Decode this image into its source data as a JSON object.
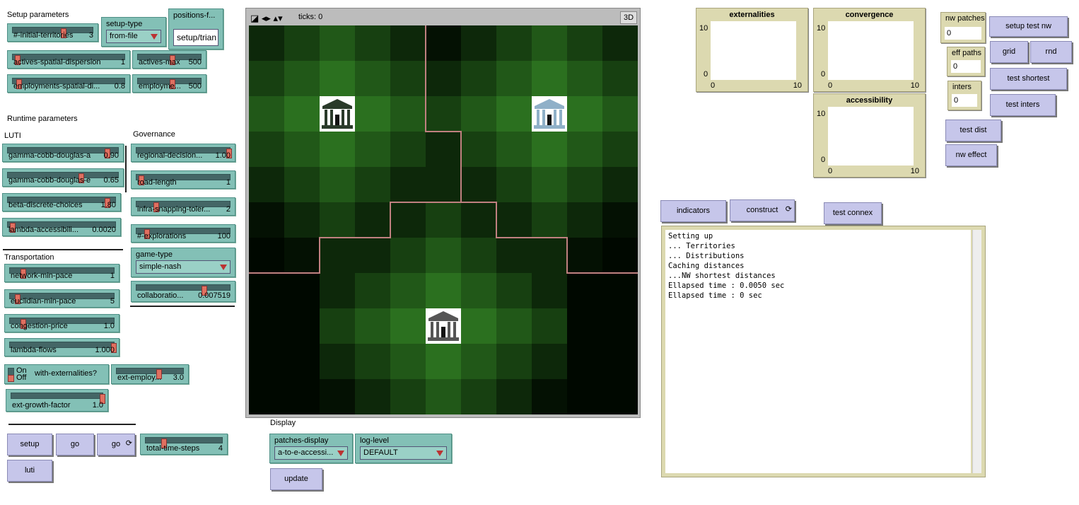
{
  "sections": {
    "setup_parameters": "Setup parameters",
    "runtime_parameters": "Runtime parameters",
    "luti": "LUTI",
    "governance": "Governance",
    "transportation": "Transportation",
    "display": "Display"
  },
  "setup": {
    "initial_territories": {
      "name": "#-initial-territories",
      "value": "3",
      "level": 0.6
    },
    "setup_type": {
      "name": "setup-type",
      "value": "from-file"
    },
    "positions_file": {
      "name": "positions-f...",
      "value": "setup/trian"
    },
    "actives_spatial_dispersion": {
      "name": "actives-spatial-dispersion",
      "value": "1",
      "level": 0.02
    },
    "actives_max": {
      "name": "actives-max",
      "value": "500",
      "level": 0.5
    },
    "employments_spatial": {
      "name": "employments-spatial-di...",
      "value": "0.8",
      "level": 0.03
    },
    "employments_max": {
      "name": "employme...",
      "value": "500",
      "level": 0.5
    }
  },
  "luti": {
    "gamma_cd_a": {
      "name": "gamma-cobb-douglas-a",
      "value": "0.90",
      "level": 0.9
    },
    "gamma_cd_e": {
      "name": "gamma-cobb-douglas-e",
      "value": "0.65",
      "level": 0.65
    },
    "beta_discrete": {
      "name": "beta-discrete-choices",
      "value": "1.80",
      "level": 0.92
    },
    "lambda_access": {
      "name": "lambda-accessibili...",
      "value": "0.0020",
      "level": 0.02
    }
  },
  "governance": {
    "regional_decision": {
      "name": "regional-decision...",
      "value": "1.00",
      "level": 1.0
    },
    "road_length": {
      "name": "road-length",
      "value": "1",
      "level": 0.02
    },
    "infra_snapping": {
      "name": "infra-snapping-toler...",
      "value": "2",
      "level": 0.18
    },
    "explorations": {
      "name": "#-explorations",
      "value": "100",
      "level": 0.08
    },
    "game_type": {
      "name": "game-type",
      "value": "simple-nash"
    },
    "collaboration": {
      "name": "collaboratio...",
      "value": "0.007519",
      "level": 0.7
    }
  },
  "transportation": {
    "network_min_pace": {
      "name": "network-min-pace",
      "value": "1",
      "level": 0.1
    },
    "euclidian_min_pace": {
      "name": "euclidian-min-pace",
      "value": "5",
      "level": 0.05
    },
    "congestion_price": {
      "name": "congestion-price",
      "value": "1.0",
      "level": 0.1
    },
    "lambda_flows": {
      "name": "lambda-flows",
      "value": "1.000",
      "level": 1.0
    }
  },
  "externalities": {
    "switch_on": "On",
    "switch_off": "Off",
    "switch_name": "with-externalities?",
    "ext_employ": {
      "name": "ext-employ...",
      "value": "3.0",
      "level": 0.6
    },
    "ext_growth": {
      "name": "ext-growth-factor",
      "value": "1.0",
      "level": 1.0
    }
  },
  "controls": {
    "setup": "setup",
    "go": "go",
    "go_forever": "go",
    "total_time_steps": {
      "name": "total-time-steps",
      "value": "4",
      "level": 0.2
    },
    "luti": "luti"
  },
  "view": {
    "ticks": "ticks: 0",
    "three_d": "3D"
  },
  "display": {
    "patches_display": {
      "name": "patches-display",
      "value": "a-to-e-accessi..."
    },
    "log_level": {
      "name": "log-level",
      "value": "DEFAULT"
    },
    "update": "update"
  },
  "plots": {
    "externalities": {
      "title": "externalities",
      "ymax": "10",
      "ymin": "0",
      "xmin": "0",
      "xmax": "10"
    },
    "convergence": {
      "title": "convergence",
      "ymax": "10",
      "ymin": "0",
      "xmin": "0",
      "xmax": "10"
    },
    "accessibility": {
      "title": "accessibility",
      "ymax": "10",
      "ymin": "0",
      "xmin": "0",
      "xmax": "10"
    }
  },
  "network": {
    "nw_patches": {
      "name": "nw patches",
      "value": "0"
    },
    "eff_paths": {
      "name": "eff paths",
      "value": "0"
    },
    "inters": {
      "name": "inters",
      "value": "0"
    },
    "setup_test_nw": "setup test nw",
    "grid": "grid",
    "rnd": "rnd",
    "test_shortest": "test shortest",
    "test_inters": "test inters",
    "test_dist": "test dist",
    "nw_effect": "nw effect",
    "indicators": "indicators",
    "construct": "construct",
    "test_connex": "test connex"
  },
  "output": {
    "lines": [
      "Setting up",
      "... Territories",
      "... Distributions",
      "Caching distances",
      "...NW shortest distances",
      "Ellapsed time : 0.0050 sec",
      "Ellapsed time : 0 sec"
    ]
  },
  "colors": {
    "slider": "#83c0b6",
    "button": "#c6c6ea",
    "monitor": "#dcd9b0",
    "boundary": "#c08080"
  }
}
